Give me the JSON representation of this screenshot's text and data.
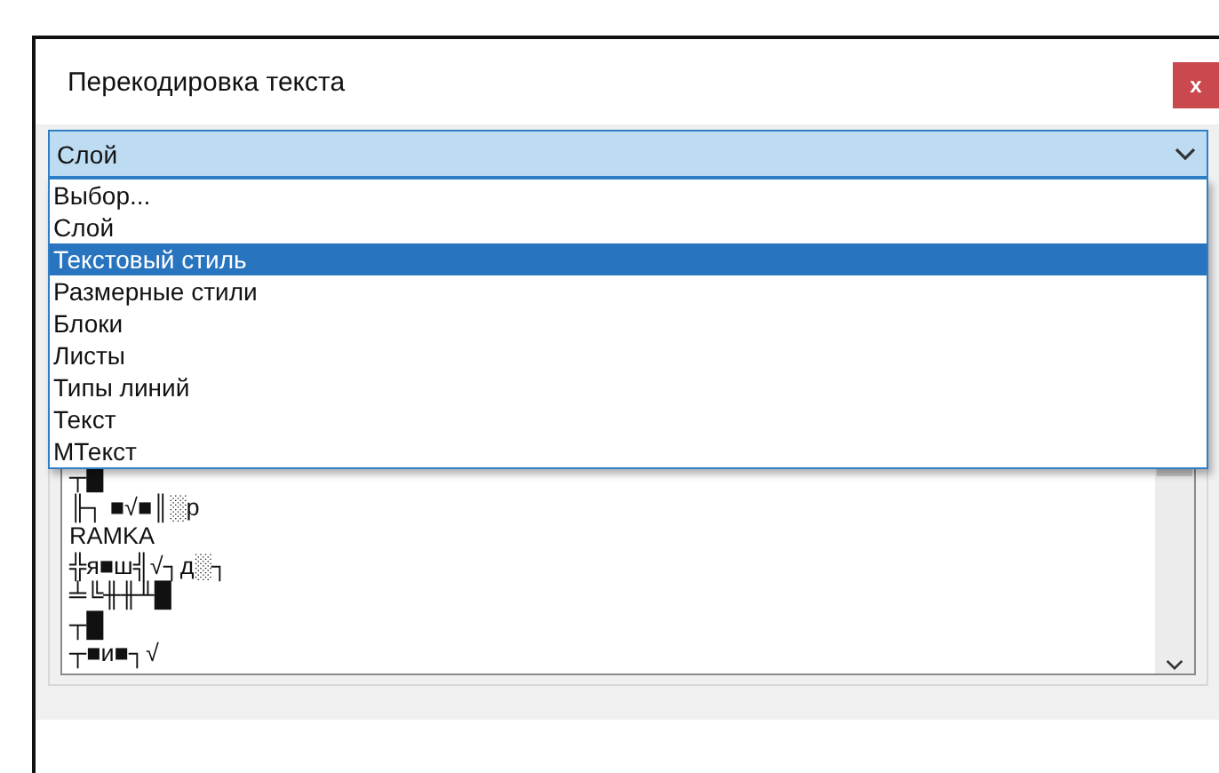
{
  "window": {
    "title": "Перекодировка текста",
    "close": "x"
  },
  "combo": {
    "value": "Слой",
    "expanded": true
  },
  "dropdown": {
    "options": [
      {
        "label": "Выбор...",
        "selected": false
      },
      {
        "label": "Слой",
        "selected": false
      },
      {
        "label": "Текстовый стиль",
        "selected": true
      },
      {
        "label": "Размерные стили",
        "selected": false
      },
      {
        "label": "Блоки",
        "selected": false
      },
      {
        "label": "Листы",
        "selected": false
      },
      {
        "label": "Типы линий",
        "selected": false
      },
      {
        "label": "Текст",
        "selected": false
      },
      {
        "label": "МТекст",
        "selected": false
      }
    ]
  },
  "list": {
    "items": [
      "┬█",
      "╟┐ ■√■║░р",
      "RAMKA",
      "╬я■ш╣√┐д░┐",
      "╧╚╫╫╨█",
      "┬█",
      "┬■и■┐√"
    ]
  }
}
